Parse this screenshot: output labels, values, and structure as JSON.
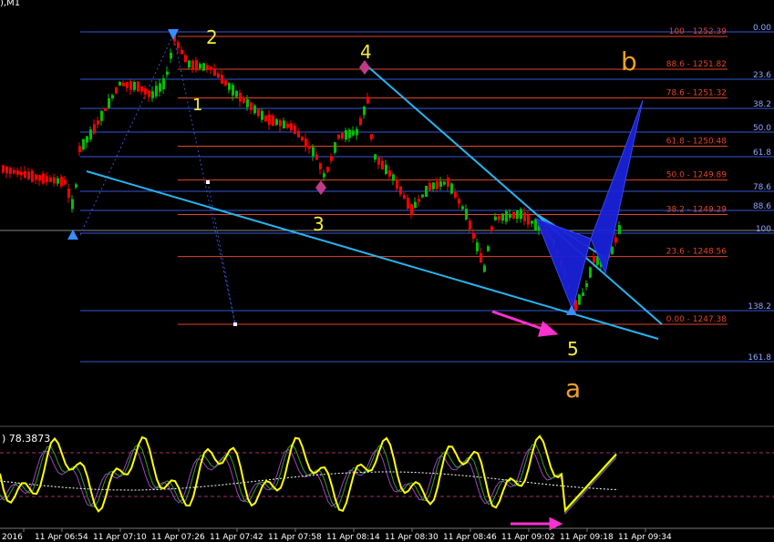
{
  "window": {
    "symbol_suffix": "),M1",
    "oscillator_value": ") 78.3873"
  },
  "colors": {
    "background": "#000000",
    "bull_candle": "#00c000",
    "bear_candle": "#ff0000",
    "fib_red": "#e0452a",
    "fib_blue": "#3557d6",
    "trendline": "#27b4f0",
    "pattern_fill": "#1a22d8",
    "wave_label": "#f4ec3c",
    "abc_label": "#f0a020",
    "arrow_magenta": "#ff30d0",
    "osc_main": "#ffff00",
    "osc_signal_1": "#2ca02c",
    "osc_signal_2": "#a040c0",
    "osc_ma": "#ffffff",
    "osc_level": "#9c2f6c",
    "axis_text": "#ffffff"
  },
  "chart_data": {
    "type": "candlestick",
    "timeframe": "M1",
    "x_ticks": [
      "2016",
      "11 Apr 06:54",
      "11 Apr 07:10",
      "11 Apr 07:26",
      "11 Apr 07:42",
      "11 Apr 07:58",
      "11 Apr 08:14",
      "11 Apr 08:30",
      "11 Apr 08:46",
      "11 Apr 09:02",
      "11 Apr 09:18",
      "11 Apr 09:34"
    ],
    "fib_retracement": {
      "color": "red",
      "levels": [
        {
          "label": "100 - 1252.39",
          "price": 1252.39
        },
        {
          "label": "88.6 - 1251.82",
          "price": 1251.82
        },
        {
          "label": "78.6 - 1251.32",
          "price": 1251.32
        },
        {
          "label": "61.8 - 1250.48",
          "price": 1250.48
        },
        {
          "label": "50.0 - 1249.89",
          "price": 1249.89
        },
        {
          "label": "38.2 - 1249.29",
          "price": 1249.29
        },
        {
          "label": "23.6 - 1248.56",
          "price": 1248.56
        },
        {
          "label": "0.00 - 1247.38",
          "price": 1247.38
        }
      ]
    },
    "fib_extension": {
      "color": "blue",
      "levels": [
        "0.00",
        "23.6",
        "38.2",
        "50.0",
        "61.8",
        "78.6",
        "88.6",
        "100",
        "138.2",
        "161.8"
      ]
    },
    "wave_labels": [
      "2",
      "1",
      "4",
      "3",
      "5"
    ],
    "correction_labels": [
      "b",
      "a"
    ],
    "oscillator": {
      "value": 78.3873,
      "levels": [
        "upper",
        "lower"
      ]
    }
  }
}
